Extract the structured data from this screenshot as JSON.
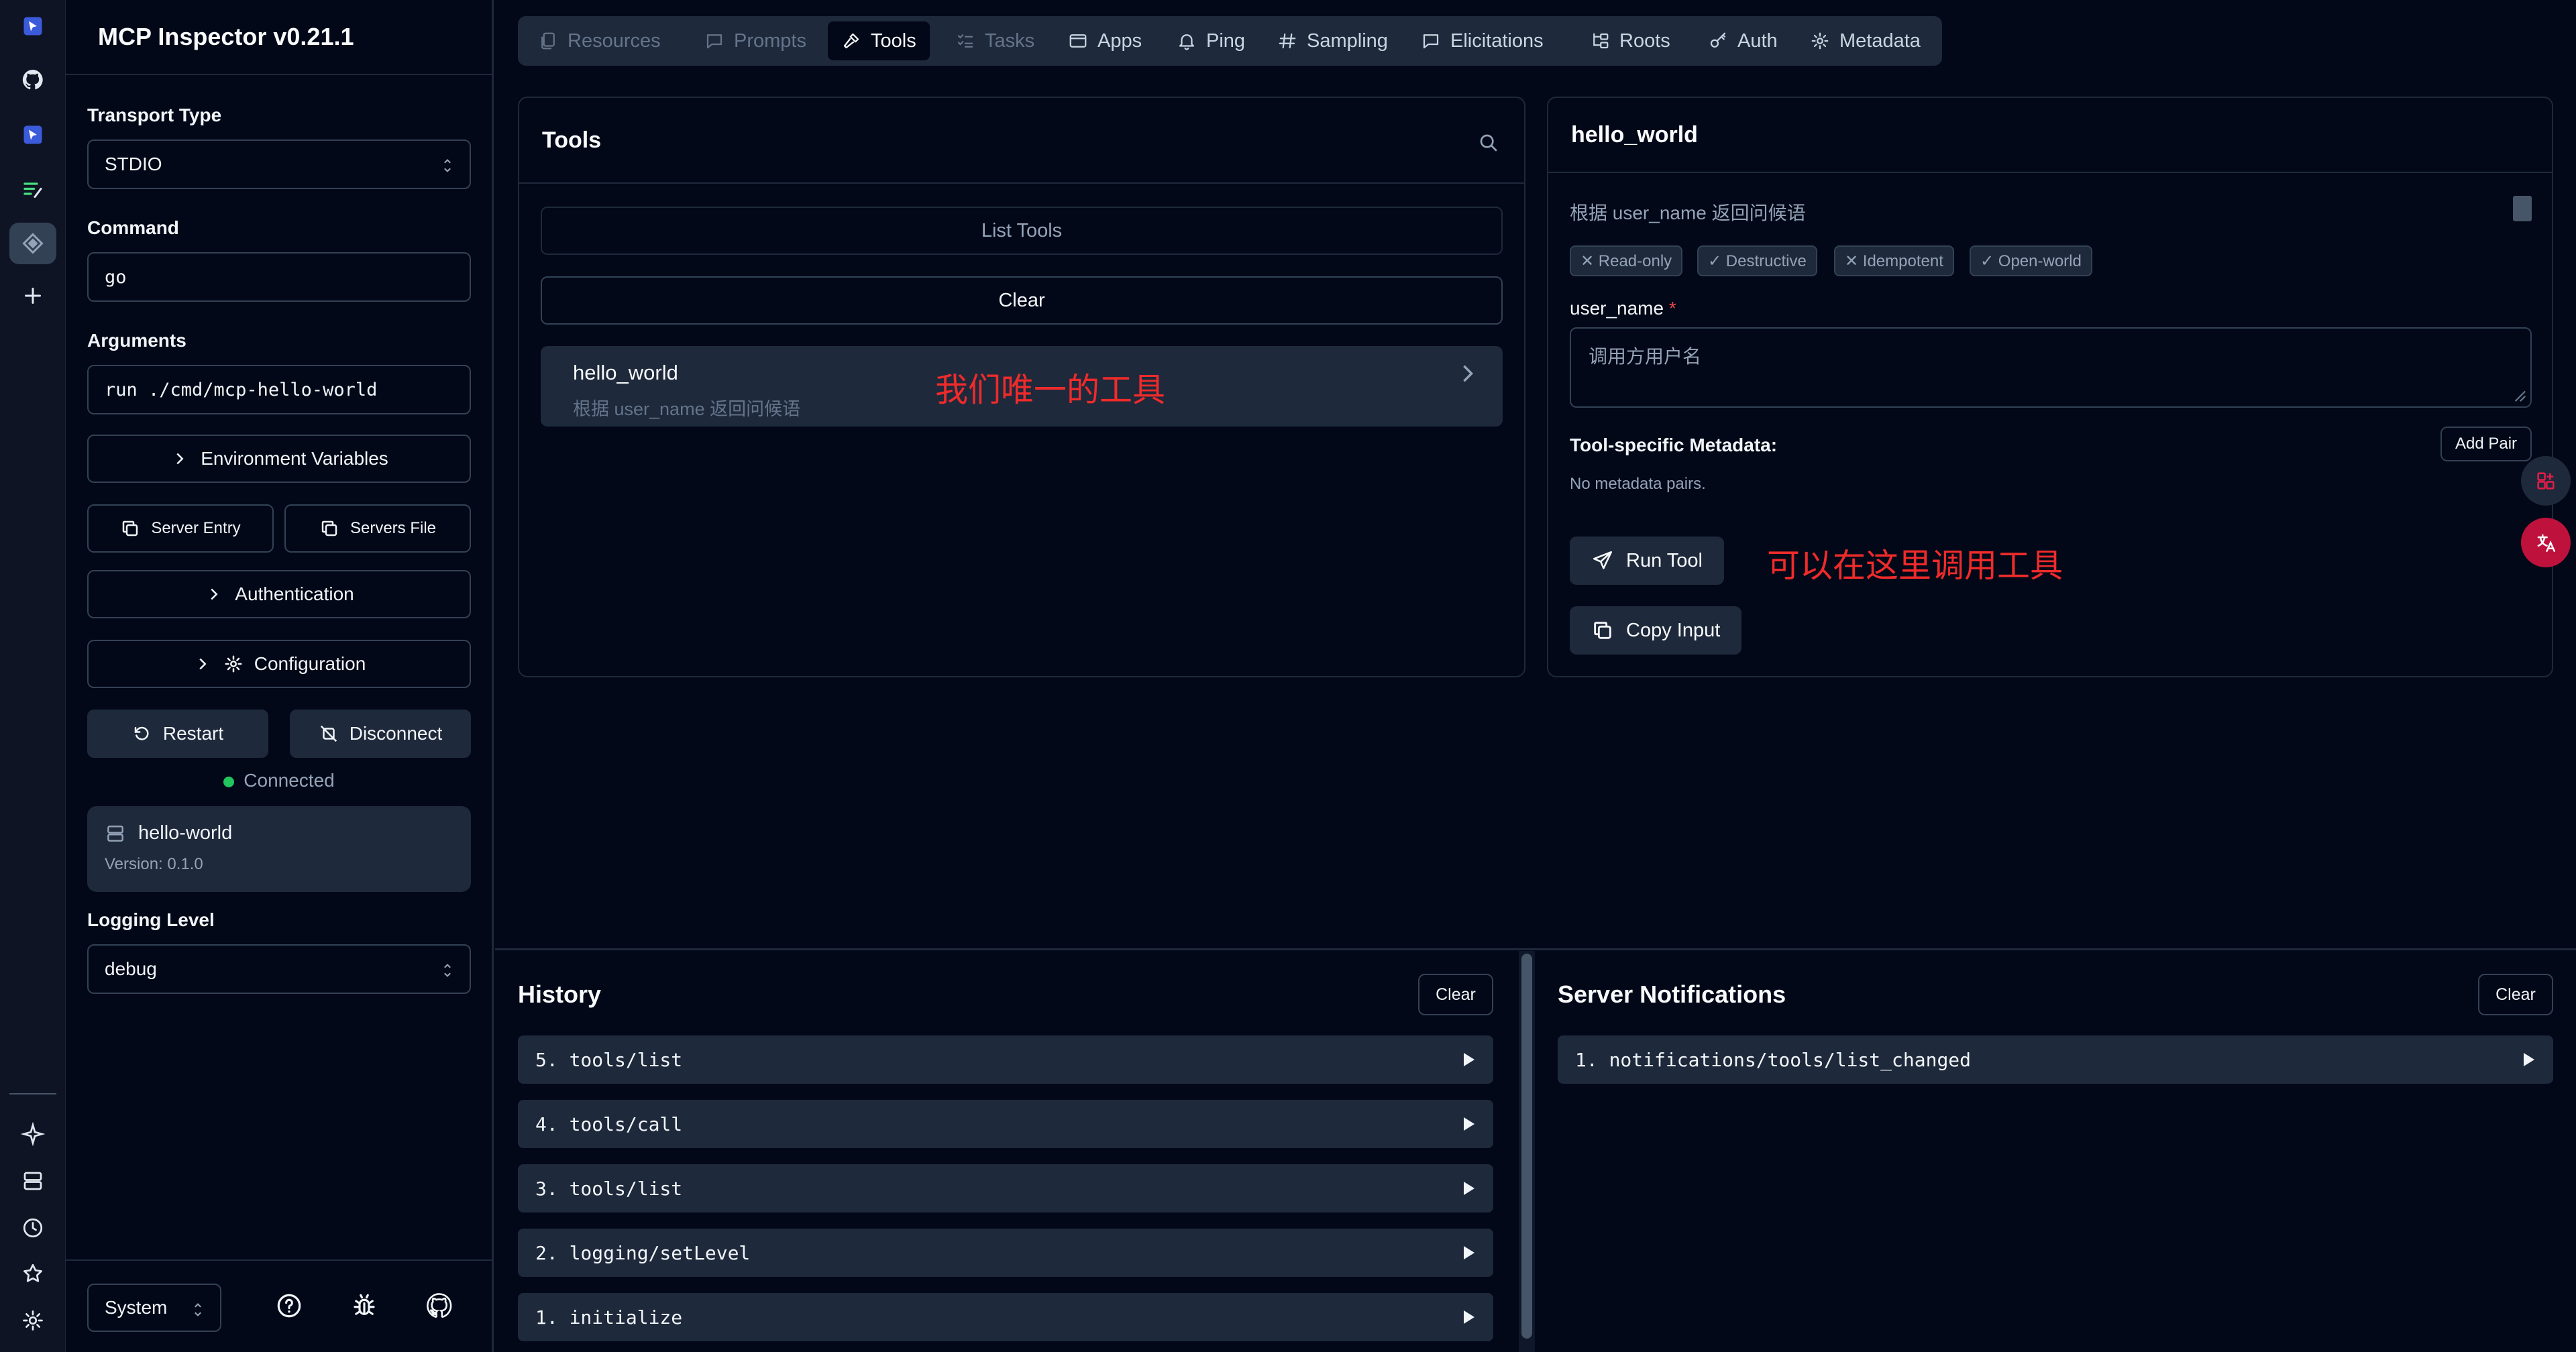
{
  "app": {
    "title": "MCP Inspector v0.21.1"
  },
  "rail": {
    "icons": [
      "logo-icon",
      "github-icon",
      "cursor-icon",
      "list-icon",
      "gem-icon",
      "plus-icon",
      "sparkle-icon",
      "server-icon",
      "clock-icon",
      "star-icon",
      "settings-icon"
    ]
  },
  "sidebar": {
    "transport_label": "Transport Type",
    "transport_value": "STDIO",
    "command_label": "Command",
    "command_value": "go",
    "arguments_label": "Arguments",
    "arguments_value": "run ./cmd/mcp-hello-world",
    "env_vars_label": "Environment Variables",
    "server_entry_label": "Server Entry",
    "servers_file_label": "Servers File",
    "authentication_label": "Authentication",
    "configuration_label": "Configuration",
    "restart_label": "Restart",
    "disconnect_label": "Disconnect",
    "status_text": "Connected",
    "server": {
      "name": "hello-world",
      "version": "Version: 0.1.0"
    },
    "logging_label": "Logging Level",
    "logging_value": "debug",
    "theme_value": "System"
  },
  "tabs": [
    {
      "label": "Resources",
      "state": "disabled"
    },
    {
      "label": "Prompts",
      "state": "disabled"
    },
    {
      "label": "Tools",
      "state": "active"
    },
    {
      "label": "Tasks",
      "state": "disabled"
    },
    {
      "label": "Apps",
      "state": "enabled"
    },
    {
      "label": "Ping",
      "state": "enabled"
    },
    {
      "label": "Sampling",
      "state": "enabled"
    },
    {
      "label": "Elicitations",
      "state": "enabled"
    },
    {
      "label": "Roots",
      "state": "enabled"
    },
    {
      "label": "Auth",
      "state": "enabled"
    },
    {
      "label": "Metadata",
      "state": "enabled"
    }
  ],
  "tools_panel": {
    "title": "Tools",
    "list_tools_label": "List Tools",
    "clear_label": "Clear",
    "items": [
      {
        "name": "hello_world",
        "description": "根据 user_name 返回问候语"
      }
    ],
    "annotation": "我们唯一的工具"
  },
  "detail_panel": {
    "title": "hello_world",
    "description": "根据 user_name 返回问候语",
    "badges": [
      "✕ Read-only",
      "✓ Destructive",
      "✕ Idempotent",
      "✓ Open-world"
    ],
    "param_label": "user_name",
    "param_required": "*",
    "param_placeholder": "调用方用户名",
    "metadata_label": "Tool-specific Metadata:",
    "add_pair_label": "Add Pair",
    "no_metadata_text": "No metadata pairs.",
    "run_tool_label": "Run Tool",
    "copy_input_label": "Copy Input",
    "annotation": "可以在这里调用工具"
  },
  "history": {
    "title": "History",
    "clear_label": "Clear",
    "items": [
      "5. tools/list",
      "4. tools/call",
      "3. tools/list",
      "2. logging/setLevel",
      "1. initialize"
    ]
  },
  "notifications": {
    "title": "Server Notifications",
    "clear_label": "Clear",
    "items": [
      "1. notifications/tools/list_changed"
    ]
  },
  "colors": {
    "background": "#020817",
    "surface": "#1e293b",
    "accent_annotation": "#ef2b2b",
    "status_connected": "#22c55e"
  }
}
